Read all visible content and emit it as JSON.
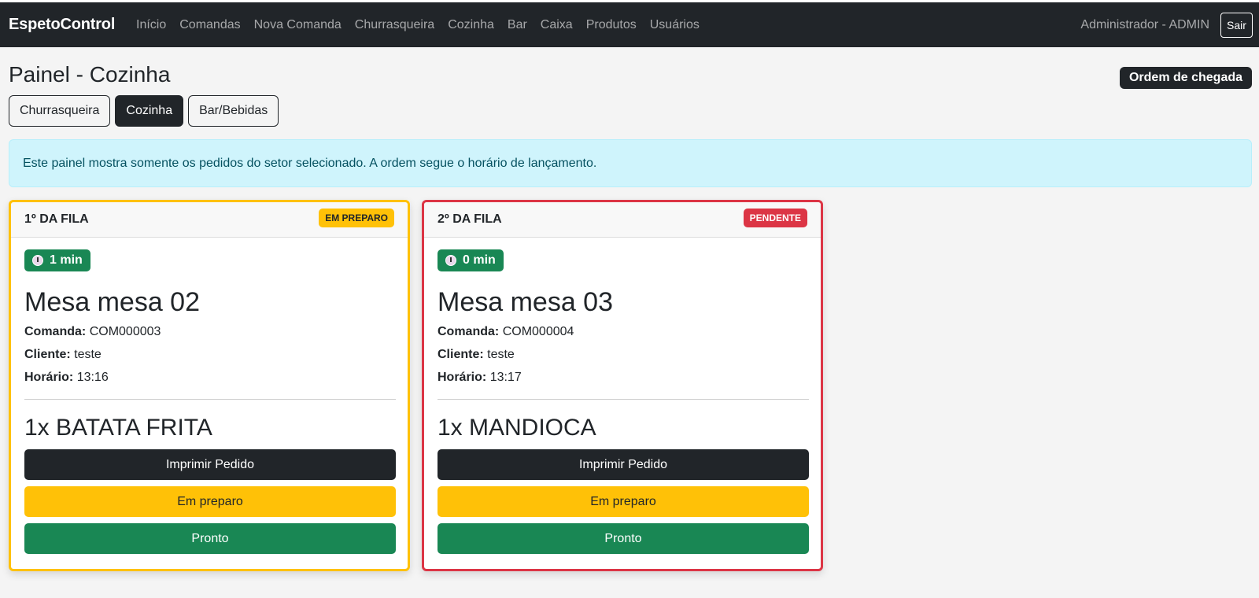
{
  "navbar": {
    "brand": "EspetoControl",
    "links": [
      "Início",
      "Comandas",
      "Nova Comanda",
      "Churrasqueira",
      "Cozinha",
      "Bar",
      "Caixa",
      "Produtos",
      "Usuários"
    ],
    "user": "Administrador - ADMIN",
    "logout_label": "Sair"
  },
  "page": {
    "title": "Painel - Cozinha",
    "order_badge": "Ordem de chegada",
    "tabs": [
      {
        "label": "Churrasqueira",
        "active": false
      },
      {
        "label": "Cozinha",
        "active": true
      },
      {
        "label": "Bar/Bebidas",
        "active": false
      }
    ],
    "alert": "Este painel mostra somente os pedidos do setor selecionado. A ordem segue o horário de lançamento."
  },
  "labels": {
    "comanda": "Comanda:",
    "cliente": "Cliente:",
    "horario": "Horário:",
    "print_button": "Imprimir Pedido",
    "preparing_button": "Em preparo",
    "ready_button": "Pronto"
  },
  "colors": {
    "em_preparo": "#ffc107",
    "pendente": "#dc3545",
    "success": "#198754",
    "dark": "#212529"
  },
  "orders": [
    {
      "queue_label": "1º DA FILA",
      "status": "EM PREPARO",
      "status_color": "#ffc107",
      "timer": "1 min",
      "table": "Mesa mesa 02",
      "comanda": "COM000003",
      "cliente": "teste",
      "horario": "13:16",
      "item": "1x BATATA FRITA"
    },
    {
      "queue_label": "2º DA FILA",
      "status": "PENDENTE",
      "status_color": "#dc3545",
      "timer": "0 min",
      "table": "Mesa mesa 03",
      "comanda": "COM000004",
      "cliente": "teste",
      "horario": "13:17",
      "item": "1x MANDIOCA"
    }
  ]
}
